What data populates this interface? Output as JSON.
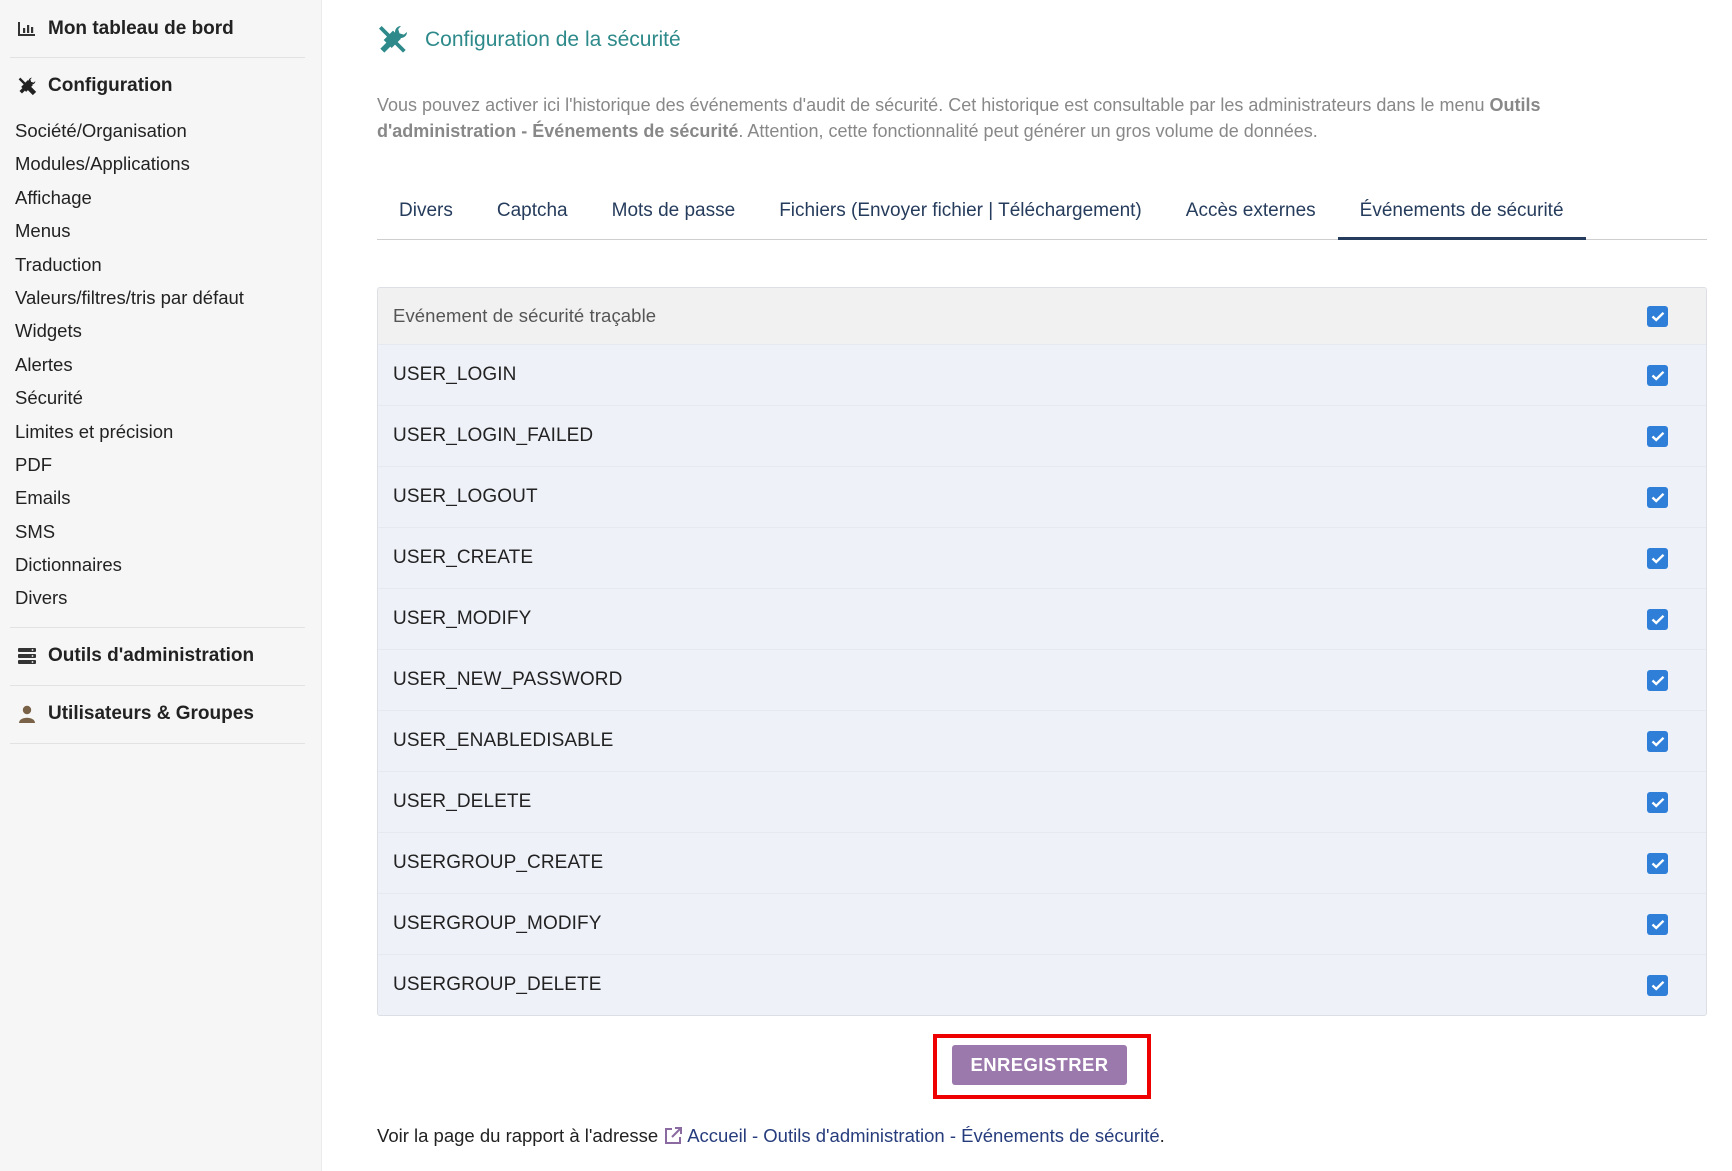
{
  "sidebar": {
    "dashboard": {
      "label": "Mon tableau de bord",
      "icon": "chart-bar-icon"
    },
    "configuration": {
      "label": "Configuration",
      "icon": "tools-icon",
      "items": [
        "Société/Organisation",
        "Modules/Applications",
        "Affichage",
        "Menus",
        "Traduction",
        "Valeurs/filtres/tris par défaut",
        "Widgets",
        "Alertes",
        "Sécurité",
        "Limites et précision",
        "PDF",
        "Emails",
        "SMS",
        "Dictionnaires",
        "Divers"
      ]
    },
    "admin_tools": {
      "label": "Outils d'administration",
      "icon": "server-icon"
    },
    "users_groups": {
      "label": "Utilisateurs & Groupes",
      "icon": "user-icon"
    }
  },
  "page": {
    "title": "Configuration de la sécurité",
    "title_icon": "tools-icon",
    "title_color": "#2e8a8a",
    "description_part1": "Vous pouvez activer ici l'historique des événements d'audit de sécurité. Cet historique est consultable par les administrateurs dans le menu ",
    "description_bold": "Outils d'administration - Événements de sécurité",
    "description_part2": ". Attention, cette fonctionnalité peut générer un gros volume de données."
  },
  "tabs": [
    {
      "label": "Divers",
      "active": false
    },
    {
      "label": "Captcha",
      "active": false
    },
    {
      "label": "Mots de passe",
      "active": false
    },
    {
      "label": "Fichiers (Envoyer fichier | Téléchargement)",
      "active": false
    },
    {
      "label": "Accès externes",
      "active": false
    },
    {
      "label": "Événements de sécurité",
      "active": true
    }
  ],
  "events_table": {
    "header": "Evénement de sécurité traçable",
    "header_checked": true,
    "rows": [
      {
        "label": "USER_LOGIN",
        "checked": true
      },
      {
        "label": "USER_LOGIN_FAILED",
        "checked": true
      },
      {
        "label": "USER_LOGOUT",
        "checked": true
      },
      {
        "label": "USER_CREATE",
        "checked": true
      },
      {
        "label": "USER_MODIFY",
        "checked": true
      },
      {
        "label": "USER_NEW_PASSWORD",
        "checked": true
      },
      {
        "label": "USER_ENABLEDISABLE",
        "checked": true
      },
      {
        "label": "USER_DELETE",
        "checked": true
      },
      {
        "label": "USERGROUP_CREATE",
        "checked": true
      },
      {
        "label": "USERGROUP_MODIFY",
        "checked": true
      },
      {
        "label": "USERGROUP_DELETE",
        "checked": true
      }
    ]
  },
  "save_button": {
    "label": "ENREGISTRER",
    "color": "#9c79ad",
    "highlight_color": "#ee0000"
  },
  "report": {
    "prefix": "Voir la page du rapport à l'adresse ",
    "link_icon": "external-link-icon",
    "link_text": "Accueil - Outils d'administration - Événements de sécurité",
    "suffix": "."
  }
}
